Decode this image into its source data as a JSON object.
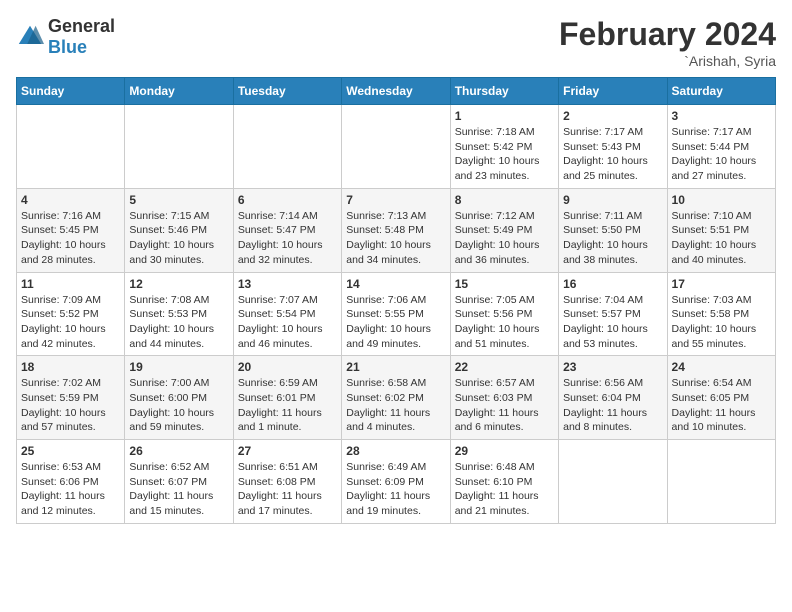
{
  "logo": {
    "text_general": "General",
    "text_blue": "Blue"
  },
  "title": {
    "month_year": "February 2024",
    "location": "`Arishah, Syria"
  },
  "days_of_week": [
    "Sunday",
    "Monday",
    "Tuesday",
    "Wednesday",
    "Thursday",
    "Friday",
    "Saturday"
  ],
  "weeks": [
    [
      {
        "day": "",
        "info": ""
      },
      {
        "day": "",
        "info": ""
      },
      {
        "day": "",
        "info": ""
      },
      {
        "day": "",
        "info": ""
      },
      {
        "day": "1",
        "info": "Sunrise: 7:18 AM\nSunset: 5:42 PM\nDaylight: 10 hours\nand 23 minutes."
      },
      {
        "day": "2",
        "info": "Sunrise: 7:17 AM\nSunset: 5:43 PM\nDaylight: 10 hours\nand 25 minutes."
      },
      {
        "day": "3",
        "info": "Sunrise: 7:17 AM\nSunset: 5:44 PM\nDaylight: 10 hours\nand 27 minutes."
      }
    ],
    [
      {
        "day": "4",
        "info": "Sunrise: 7:16 AM\nSunset: 5:45 PM\nDaylight: 10 hours\nand 28 minutes."
      },
      {
        "day": "5",
        "info": "Sunrise: 7:15 AM\nSunset: 5:46 PM\nDaylight: 10 hours\nand 30 minutes."
      },
      {
        "day": "6",
        "info": "Sunrise: 7:14 AM\nSunset: 5:47 PM\nDaylight: 10 hours\nand 32 minutes."
      },
      {
        "day": "7",
        "info": "Sunrise: 7:13 AM\nSunset: 5:48 PM\nDaylight: 10 hours\nand 34 minutes."
      },
      {
        "day": "8",
        "info": "Sunrise: 7:12 AM\nSunset: 5:49 PM\nDaylight: 10 hours\nand 36 minutes."
      },
      {
        "day": "9",
        "info": "Sunrise: 7:11 AM\nSunset: 5:50 PM\nDaylight: 10 hours\nand 38 minutes."
      },
      {
        "day": "10",
        "info": "Sunrise: 7:10 AM\nSunset: 5:51 PM\nDaylight: 10 hours\nand 40 minutes."
      }
    ],
    [
      {
        "day": "11",
        "info": "Sunrise: 7:09 AM\nSunset: 5:52 PM\nDaylight: 10 hours\nand 42 minutes."
      },
      {
        "day": "12",
        "info": "Sunrise: 7:08 AM\nSunset: 5:53 PM\nDaylight: 10 hours\nand 44 minutes."
      },
      {
        "day": "13",
        "info": "Sunrise: 7:07 AM\nSunset: 5:54 PM\nDaylight: 10 hours\nand 46 minutes."
      },
      {
        "day": "14",
        "info": "Sunrise: 7:06 AM\nSunset: 5:55 PM\nDaylight: 10 hours\nand 49 minutes."
      },
      {
        "day": "15",
        "info": "Sunrise: 7:05 AM\nSunset: 5:56 PM\nDaylight: 10 hours\nand 51 minutes."
      },
      {
        "day": "16",
        "info": "Sunrise: 7:04 AM\nSunset: 5:57 PM\nDaylight: 10 hours\nand 53 minutes."
      },
      {
        "day": "17",
        "info": "Sunrise: 7:03 AM\nSunset: 5:58 PM\nDaylight: 10 hours\nand 55 minutes."
      }
    ],
    [
      {
        "day": "18",
        "info": "Sunrise: 7:02 AM\nSunset: 5:59 PM\nDaylight: 10 hours\nand 57 minutes."
      },
      {
        "day": "19",
        "info": "Sunrise: 7:00 AM\nSunset: 6:00 PM\nDaylight: 10 hours\nand 59 minutes."
      },
      {
        "day": "20",
        "info": "Sunrise: 6:59 AM\nSunset: 6:01 PM\nDaylight: 11 hours\nand 1 minute."
      },
      {
        "day": "21",
        "info": "Sunrise: 6:58 AM\nSunset: 6:02 PM\nDaylight: 11 hours\nand 4 minutes."
      },
      {
        "day": "22",
        "info": "Sunrise: 6:57 AM\nSunset: 6:03 PM\nDaylight: 11 hours\nand 6 minutes."
      },
      {
        "day": "23",
        "info": "Sunrise: 6:56 AM\nSunset: 6:04 PM\nDaylight: 11 hours\nand 8 minutes."
      },
      {
        "day": "24",
        "info": "Sunrise: 6:54 AM\nSunset: 6:05 PM\nDaylight: 11 hours\nand 10 minutes."
      }
    ],
    [
      {
        "day": "25",
        "info": "Sunrise: 6:53 AM\nSunset: 6:06 PM\nDaylight: 11 hours\nand 12 minutes."
      },
      {
        "day": "26",
        "info": "Sunrise: 6:52 AM\nSunset: 6:07 PM\nDaylight: 11 hours\nand 15 minutes."
      },
      {
        "day": "27",
        "info": "Sunrise: 6:51 AM\nSunset: 6:08 PM\nDaylight: 11 hours\nand 17 minutes."
      },
      {
        "day": "28",
        "info": "Sunrise: 6:49 AM\nSunset: 6:09 PM\nDaylight: 11 hours\nand 19 minutes."
      },
      {
        "day": "29",
        "info": "Sunrise: 6:48 AM\nSunset: 6:10 PM\nDaylight: 11 hours\nand 21 minutes."
      },
      {
        "day": "",
        "info": ""
      },
      {
        "day": "",
        "info": ""
      }
    ]
  ]
}
